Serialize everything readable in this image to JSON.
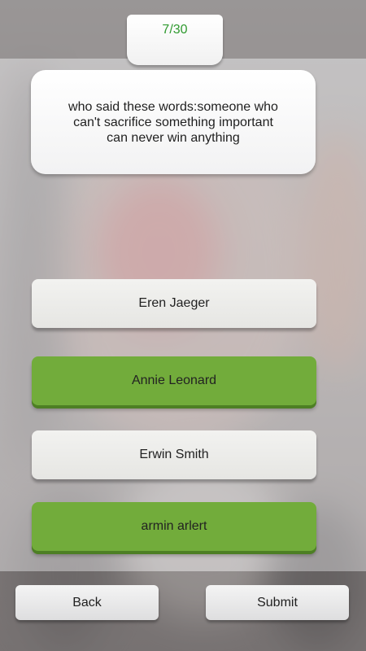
{
  "progress": {
    "label": "7/30"
  },
  "question": {
    "text": "who said these words:someone who can't sacrifice something important can never win anything"
  },
  "answers": [
    {
      "label": "Eren Jaeger",
      "color": "#e9e9e6"
    },
    {
      "label": "Annie Leonard",
      "color": "#72ac3b"
    },
    {
      "label": "Erwin Smith",
      "color": "#e9e9e6"
    },
    {
      "label": "armin arlert",
      "color": "#72ac3b"
    }
  ],
  "footer": {
    "back_label": "Back",
    "submit_label": "Submit"
  },
  "colors": {
    "counter_text": "#2f9a2f",
    "selected_answer": "#72ac3b"
  }
}
